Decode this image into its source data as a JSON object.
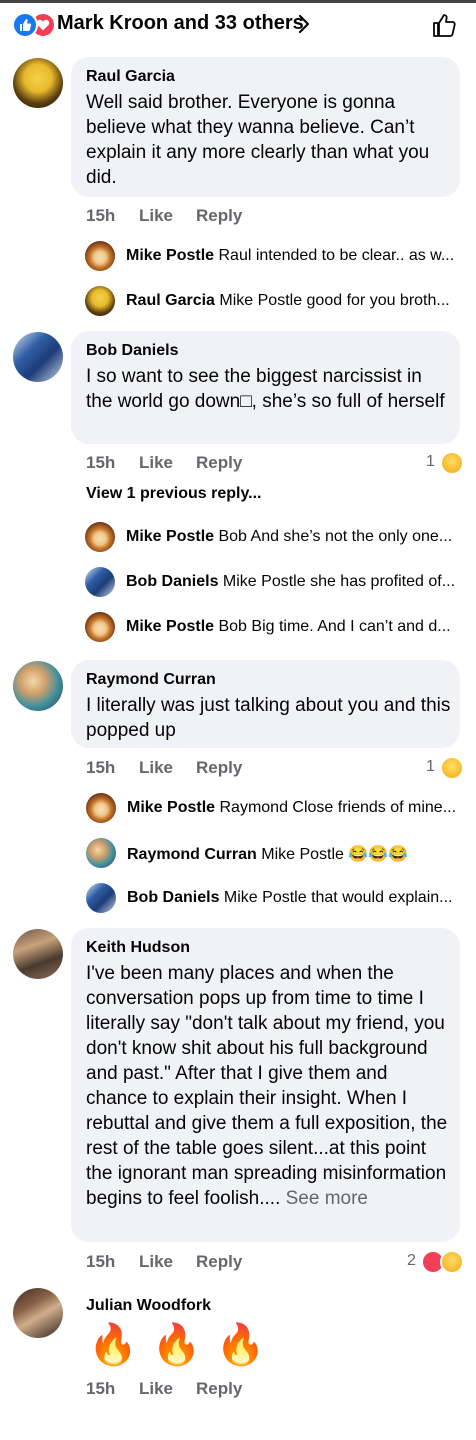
{
  "header": {
    "title": "Mark Kroon and 33 others",
    "reactions": [
      "like-icon",
      "love-icon"
    ]
  },
  "comments": [
    {
      "author": "Raul Garcia",
      "text": "Well said brother. Everyone is gonna believe what they wanna believe. Can’t explain it any more clearly than what you did.",
      "time": "15h",
      "like": "Like",
      "reply": "Reply"
    },
    {
      "author": "Bob Daniels",
      "text": "I so want to see the biggest narcissist in the world go down□, she’s so full of herself",
      "time": "15h",
      "like": "Like",
      "reply": "Reply",
      "reaction_count": "1",
      "view_previous": "View 1 previous reply..."
    },
    {
      "author": "Raymond Curran",
      "text": "I literally was just talking about you and this popped up",
      "time": "15h",
      "like": "Like",
      "reply": "Reply",
      "reaction_count": "1"
    },
    {
      "author": "Keith Hudson",
      "text": "I've been many places and when the conversation pops up from time to time I literally say \"don't talk about my friend, you don't know shit about his full background and past.\" After that I give them and chance to explain their insight. When I rebuttal and give them a full exposition, the rest of the table goes silent...at this point the ignorant man spreading misinformation begins to feel foolish....",
      "see_more": "See more",
      "time": "15h",
      "like": "Like",
      "reply": "Reply",
      "reaction_count": "2"
    },
    {
      "author": "Julian Woodfork",
      "text": "🔥🔥🔥",
      "time": "15h",
      "like": "Like",
      "reply": "Reply"
    }
  ],
  "replies": [
    {
      "name": "Mike Postle",
      "text": "Raul intended to be clear.. as w..."
    },
    {
      "name": "Raul Garcia",
      "text": "Mike Postle good for you broth..."
    },
    {
      "name": "Mike Postle",
      "text": "Bob And she’s not the only one..."
    },
    {
      "name": "Bob Daniels",
      "text": "Mike Postle she has profited of..."
    },
    {
      "name": "Mike Postle",
      "text": "Bob Big time. And I can’t and d..."
    },
    {
      "name": "Mike Postle",
      "text": "Raymond Close friends of mine..."
    },
    {
      "name": "Raymond Curran",
      "text": "Mike Postle 😂😂😂"
    },
    {
      "name": "Bob Daniels",
      "text": "Mike Postle that would explain..."
    }
  ]
}
